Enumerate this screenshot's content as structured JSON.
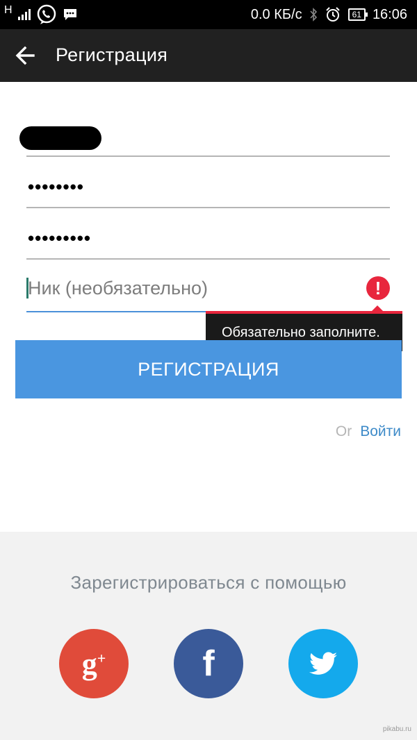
{
  "status_bar": {
    "network_letter": "H",
    "speed": "0.0 КБ/с",
    "battery": "61",
    "time": "16:06"
  },
  "app_bar": {
    "title": "Регистрация"
  },
  "form": {
    "password_dots": "••••••••",
    "password_confirm_dots": "•••••••••",
    "nick_placeholder": "Ник (необязательно)",
    "error_symbol": "!",
    "tooltip_text": "Обязательно заполните.",
    "register_button": "РЕГИСТРАЦИЯ",
    "or_text": "Or",
    "login_link": "Войти"
  },
  "social": {
    "title": "Зарегистрироваться с помощью",
    "google_label": "g",
    "google_plus": "+",
    "facebook_label": "f"
  },
  "watermark": "pikabu.ru",
  "colors": {
    "register_button": "#4a96e0",
    "error": "#e8263d",
    "google": "#e04b3a",
    "facebook": "#3a5a99",
    "twitter": "#14a9ec"
  }
}
